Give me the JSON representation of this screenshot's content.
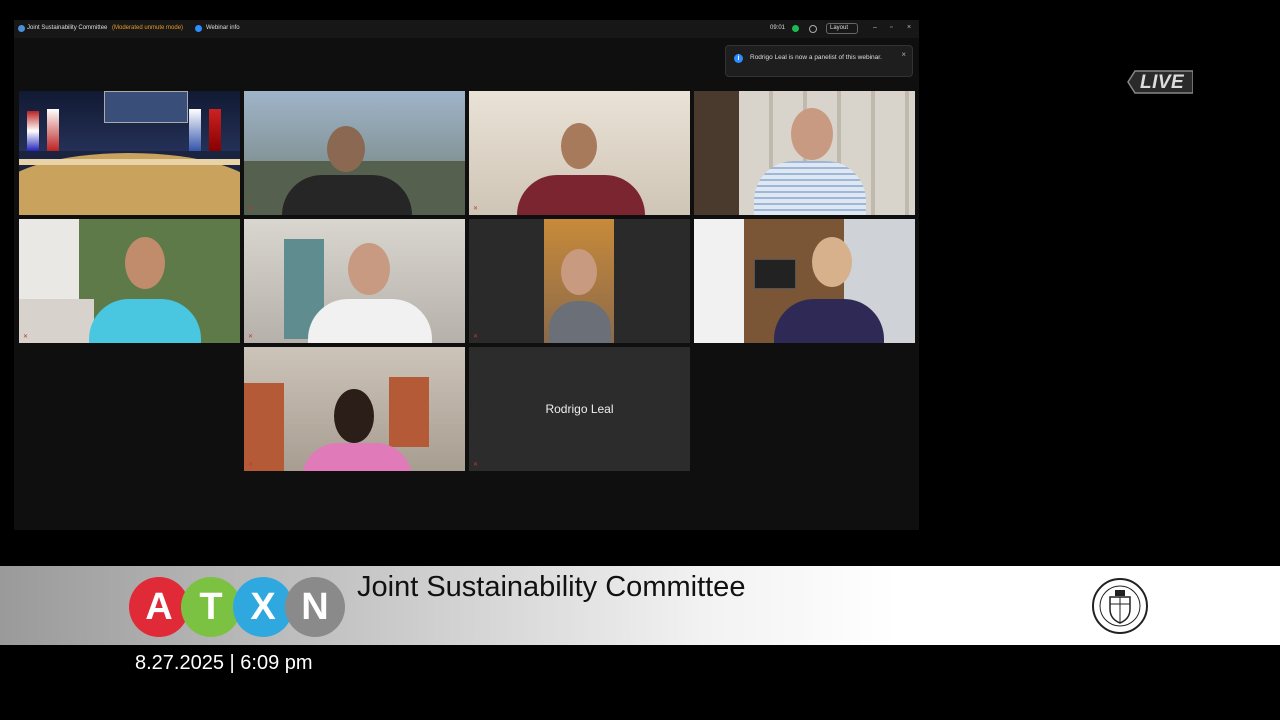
{
  "window": {
    "title": "Joint Sustainability Committee",
    "status": "(Moderated unmute mode)",
    "webinar_label": "Webinar info",
    "timer": "09:01",
    "layout_label": "Layout"
  },
  "notification": {
    "message": "Rodrigo Leal is now a panelist of this webinar.",
    "close": "×"
  },
  "participants": [
    {
      "label": ""
    },
    {
      "label": ""
    },
    {
      "label": ""
    },
    {
      "label": ""
    },
    {
      "label": ""
    },
    {
      "label": ""
    },
    {
      "label": ""
    },
    {
      "label": ""
    },
    {
      "label": ""
    },
    {
      "label": "Rodrigo Leal"
    }
  ],
  "live": "LIVE",
  "banner": {
    "logo_letters": [
      "A",
      "T",
      "X",
      "N"
    ],
    "logo_colors": [
      "#e02a37",
      "#7cc242",
      "#2fa8e0",
      "#8a8a8a"
    ],
    "title": "Joint Sustainability Committee",
    "datetime": "8.27.2025 | 6:09 pm"
  },
  "colors": {
    "status_orange": "#e39a2b",
    "accent_blue": "#2d8cff",
    "active_green": "#1db954"
  }
}
